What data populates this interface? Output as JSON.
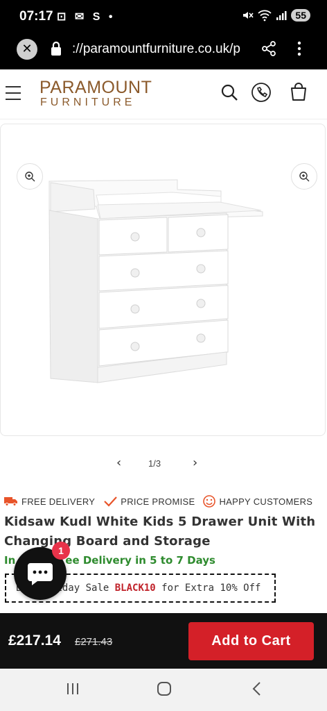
{
  "status_bar": {
    "time": "07:17",
    "notification_glyphs": "⊡ ✉ S •",
    "battery": "55"
  },
  "browser": {
    "url": "://paramountfurniture.co.uk/p"
  },
  "site": {
    "logo_line1": "PARAMOUNT",
    "logo_line2": "FURNITURE",
    "brand_color": "#8b5a2b"
  },
  "gallery": {
    "counter": "1/3"
  },
  "badges": [
    {
      "label": "FREE DELIVERY",
      "icon": "truck-icon",
      "color": "#e8542a"
    },
    {
      "label": "PRICE PROMISE",
      "icon": "check-icon",
      "color": "#e8542a"
    },
    {
      "label": "HAPPY CUSTOMERS",
      "icon": "smiley-icon",
      "color": "#e8542a"
    }
  ],
  "product": {
    "title": "Kidsaw Kudl White Kids 5 Drawer Unit With Changing Board and Storage",
    "delivery": "In Stock - Free Delivery in 5 to 7 Days",
    "delivery_visible_left": "In",
    "delivery_visible_right": "ee Delivery in 5 to 7 Days",
    "promo_prefix": "B",
    "promo_mid": "iday Sale ",
    "promo_code": "BLACK10",
    "promo_suffix": " for Extra 10% Off",
    "price": "£217.14",
    "old_price": "£271.43",
    "add_to_cart": "Add to Cart"
  },
  "chat": {
    "unread": "1"
  }
}
